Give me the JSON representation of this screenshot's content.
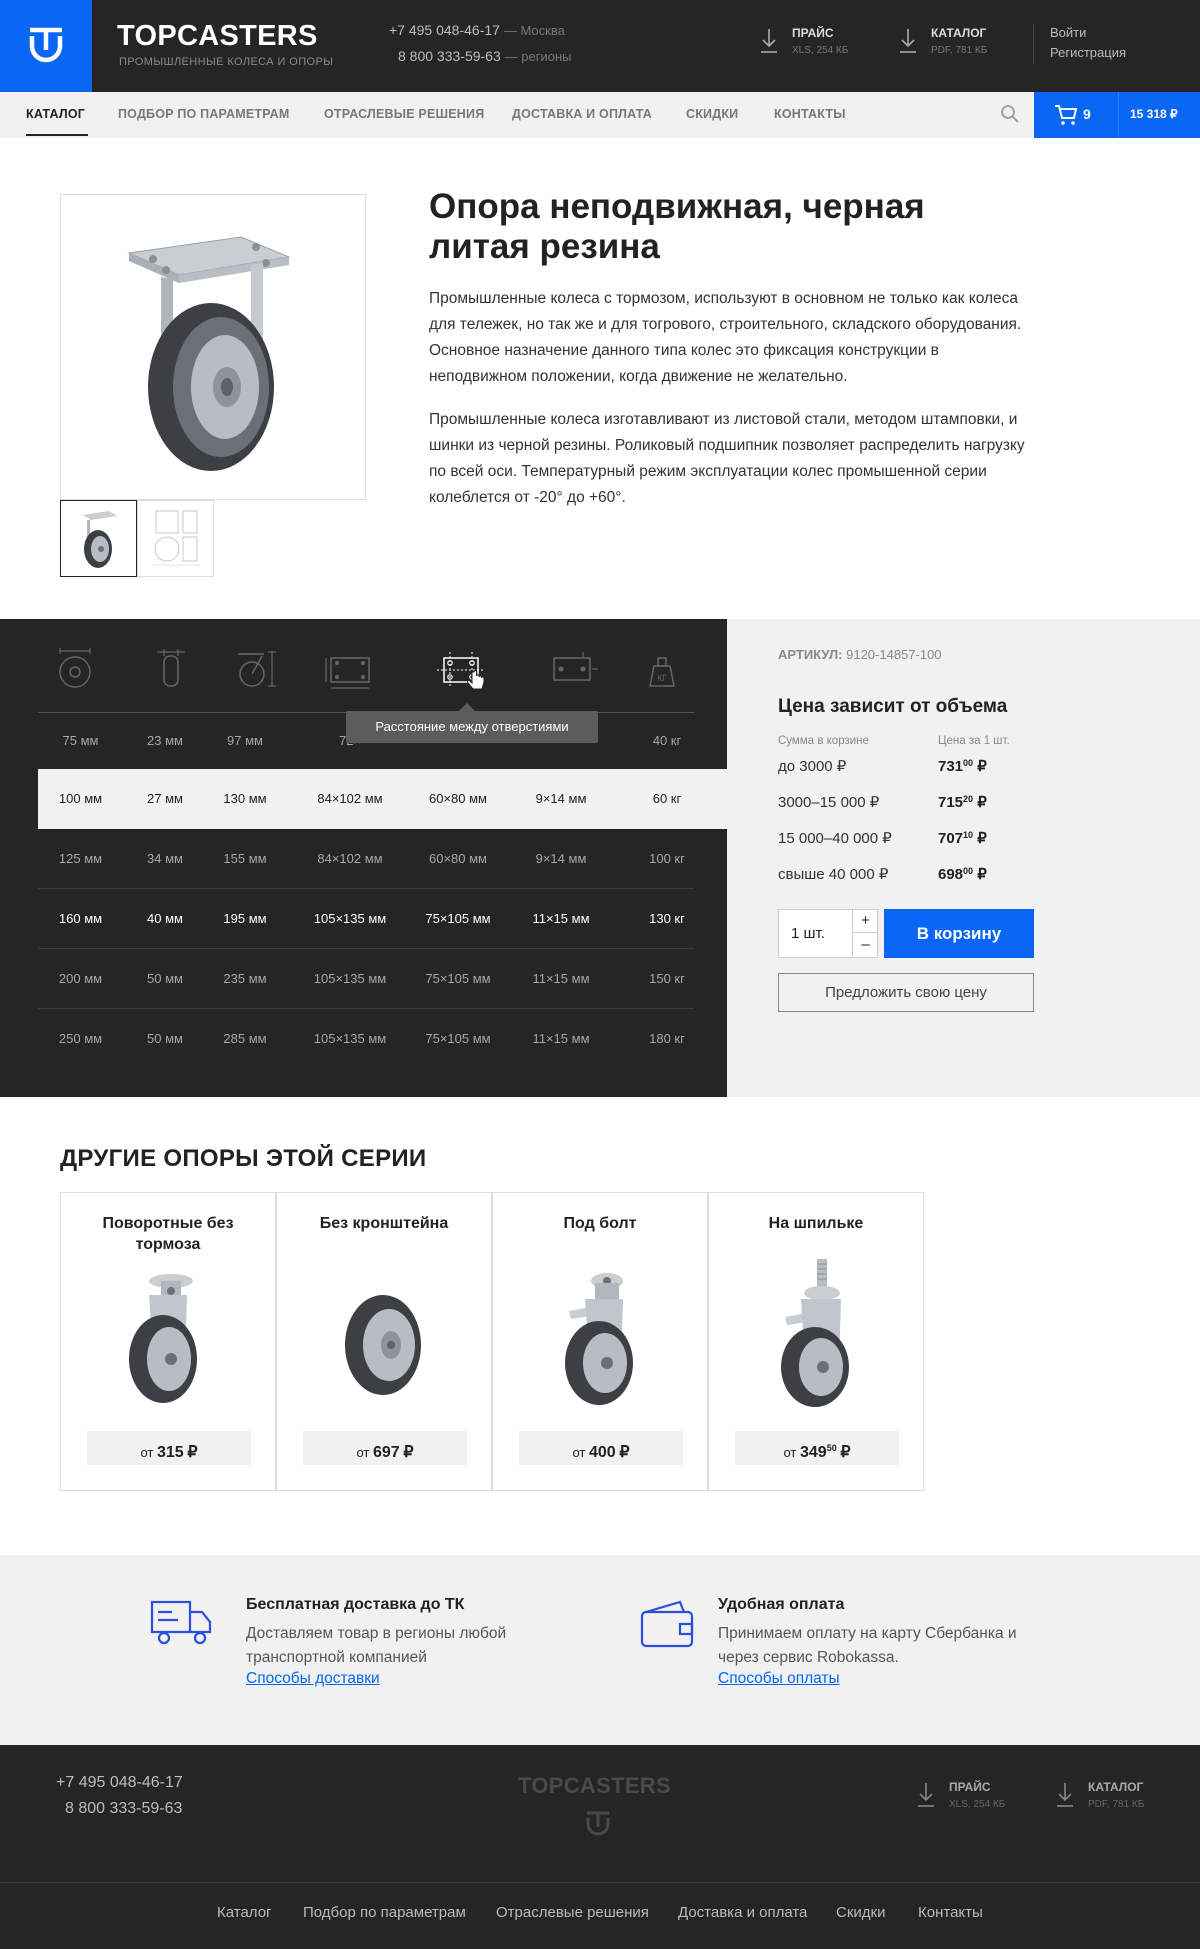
{
  "header": {
    "brand": "TOPCASTERS",
    "tagline": "ПРОМЫШЛЕННЫЕ КОЛЕСА И ОПОРЫ",
    "phones": [
      {
        "number": "+7 495 048-46-17",
        "city": "— Москва"
      },
      {
        "number": "8 800 333-59-63",
        "city": "— регионы"
      }
    ],
    "downloads": [
      {
        "title": "ПРАЙС",
        "sub": "XLS, 254 КБ"
      },
      {
        "title": "КАТАЛОГ",
        "sub": "PDF, 781 КБ"
      }
    ],
    "login": "Войти",
    "register": "Регистрация"
  },
  "nav": {
    "items": [
      "КАТАЛОГ",
      "ПОДБОР ПО ПАРАМЕТРАМ",
      "ОТРАСЛЕВЫЕ РЕШЕНИЯ",
      "ДОСТАВКА И ОПЛАТА",
      "СКИДКИ",
      "КОНТАКТЫ"
    ],
    "active": "КАТАЛОГ",
    "cart_count": "9",
    "cart_total": "15 318 ₽"
  },
  "product": {
    "title": "Опора неподвижная, черная литая резина",
    "paragraphs": [
      "Промышленные колеса с тормозом, используют в основном не только как колеса для тележек, но так же и для тогрового, строительного, складского оборудования. Основное назначение данного типа колес это фиксация конструкции в неподвижном положении, когда движение не желательно.",
      "Промышленные колеса изготавливают из листовой стали, методом штамповки, и шинки из черной резины. Роликовый подшипник позволяет распределить нагрузку по всей оси. Температурный режим эксплуатации колес промышенной серии колеблется от -20° до +60°."
    ]
  },
  "specs": {
    "columns": [
      "wheel-diameter-icon",
      "wheel-width-icon",
      "height-icon",
      "plate-size-icon",
      "hole-distance-icon",
      "hole-size-icon",
      "load-weight-icon"
    ],
    "tooltip": "Расстояние между отверстиями",
    "rows": [
      [
        "75 мм",
        "23 мм",
        "97 мм",
        "72×",
        "",
        "",
        "40 кг"
      ],
      [
        "100 мм",
        "27 мм",
        "130 мм",
        "84×102 мм",
        "60×80 мм",
        "9×14 мм",
        "60 кг"
      ],
      [
        "125 мм",
        "34 мм",
        "155 мм",
        "84×102 мм",
        "60×80 мм",
        "9×14 мм",
        "100 кг"
      ],
      [
        "160 мм",
        "40 мм",
        "195 мм",
        "105×135 мм",
        "75×105 мм",
        "11×15 мм",
        "130 кг"
      ],
      [
        "200 мм",
        "50 мм",
        "235 мм",
        "105×135 мм",
        "75×105 мм",
        "11×15 мм",
        "150 кг"
      ],
      [
        "250 мм",
        "50 мм",
        "285 мм",
        "105×135 мм",
        "75×105 мм",
        "11×15 мм",
        "180 кг"
      ]
    ],
    "selected_row": 1,
    "hovered_row": 3
  },
  "price": {
    "sku_label": "АРТИКУЛ:",
    "sku": "9120-14857-100",
    "heading": "Цена зависит от объема",
    "col_sum": "Сумма в корзине",
    "col_price": "Цена за 1 шт.",
    "tiers": [
      {
        "range": "до 3000 ₽",
        "int": "731",
        "dec": "00"
      },
      {
        "range": "3000–15 000 ₽",
        "int": "715",
        "dec": "20"
      },
      {
        "range": "15 000–40 000 ₽",
        "int": "707",
        "dec": "10"
      },
      {
        "range": "свыше 40 000 ₽",
        "int": "698",
        "dec": "00"
      }
    ],
    "currency": "₽",
    "qty": "1 шт.",
    "plus": "+",
    "minus": "–",
    "add_to_cart": "В корзину",
    "offer": "Предложить свою цену"
  },
  "related": {
    "title": "ДРУГИЕ ОПОРЫ ЭТОЙ СЕРИИ",
    "items": [
      {
        "name": "Поворотные без тормоза",
        "from": "от",
        "int": "315",
        "dec": "",
        "cur": "₽"
      },
      {
        "name": "Без кронштейна",
        "from": "от",
        "int": "697",
        "dec": "",
        "cur": "₽"
      },
      {
        "name": "Под болт",
        "from": "от",
        "int": "400",
        "dec": "",
        "cur": "₽"
      },
      {
        "name": "На шпильке",
        "from": "от",
        "int": "349",
        "dec": "50",
        "cur": "₽"
      }
    ]
  },
  "features": [
    {
      "title": "Бесплатная доставка до ТК",
      "text": "Доставляем товар в регионы любой транспортной компанией",
      "link": "Способы доставки",
      "icon": "truck-icon"
    },
    {
      "title": "Удобная оплата",
      "text": "Принимаем оплату на карту Сбербанка и через сервис Robokassa.",
      "link": "Способы оплаты",
      "icon": "wallet-icon"
    }
  ],
  "footer": {
    "phones": [
      "+7 495 048-46-17",
      "8 800 333-59-63"
    ],
    "brand": "TOPCASTERS",
    "downloads": [
      {
        "title": "ПРАЙС",
        "sub": "XLS, 254 КБ"
      },
      {
        "title": "КАТАЛОГ",
        "sub": "PDF, 781 КБ"
      }
    ],
    "nav": [
      "Каталог",
      "Подбор по параметрам",
      "Отраслевые решения",
      "Доставка и оплата",
      "Скидки",
      "Контакты"
    ]
  },
  "colors": {
    "accent": "#0a66f5",
    "dark": "#252525",
    "light": "#f1f1f1"
  }
}
